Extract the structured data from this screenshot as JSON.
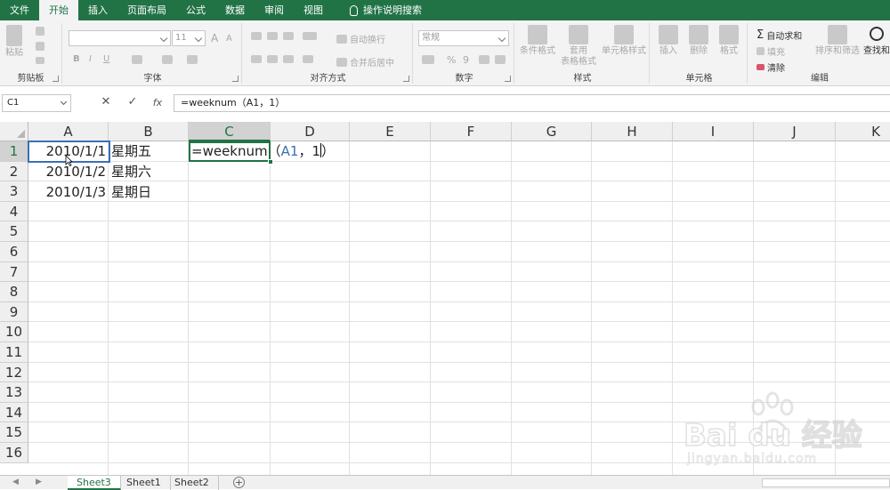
{
  "ribbon_tabs": [
    "文件",
    "开始",
    "插入",
    "页面布局",
    "公式",
    "数据",
    "审阅",
    "视图"
  ],
  "active_tab_index": 1,
  "tell_me": "操作说明搜索",
  "groups": {
    "clipboard": {
      "paste": "粘贴",
      "label": "剪贴板"
    },
    "font": {
      "size": "11",
      "bold": "B",
      "italic": "I",
      "underline": "U",
      "grow": "A",
      "shrink": "A",
      "label": "字体"
    },
    "alignment": {
      "wrap": "自动换行",
      "merge": "合并后居中",
      "label": "对齐方式"
    },
    "number": {
      "format": "常规",
      "percent": "%",
      "comma": "9",
      "label": "数字"
    },
    "styles": {
      "cond": "条件格式",
      "table1": "套用",
      "table2": "表格格式",
      "cell": "单元格样式",
      "label": "样式"
    },
    "cells": {
      "insert": "插入",
      "delete": "删除",
      "format": "格式",
      "label": "单元格"
    },
    "editing": {
      "autosum": "自动求和",
      "fill": "填充",
      "clear": "清除",
      "sort": "排序和筛选",
      "find": "查找和",
      "label": "编辑"
    }
  },
  "name_box": "C1",
  "formula_buttons": {
    "cancel": "✕",
    "enter": "✓",
    "fx": "fx"
  },
  "formula": "=weeknum（A1，1）",
  "columns": [
    "A",
    "B",
    "C",
    "D",
    "E",
    "F",
    "G",
    "H",
    "I",
    "J",
    "K"
  ],
  "selected_column": "C",
  "rows": [
    "1",
    "2",
    "3",
    "4",
    "5",
    "6",
    "7",
    "8",
    "9",
    "10",
    "11",
    "12",
    "13",
    "14",
    "15",
    "16"
  ],
  "cells": {
    "A1": "2010/1/1",
    "A2": "2010/1/2",
    "A3": "2010/1/3",
    "B1": "星期五",
    "B2": "星期六",
    "B3": "星期日"
  },
  "editing_cell": {
    "func": "=weeknum",
    "open": "（",
    "ref": "A1",
    "sep": "，",
    "arg": "1",
    "close": "）"
  },
  "sheets": [
    "Sheet3",
    "Sheet1",
    "Sheet2"
  ],
  "active_sheet": "Sheet3",
  "add_sheet": "+",
  "watermark": {
    "brand": "Bai du 经验",
    "url": "jingyan.baidu.com"
  },
  "colors": {
    "accent": "#217346",
    "ref": "#3b6fb6"
  }
}
